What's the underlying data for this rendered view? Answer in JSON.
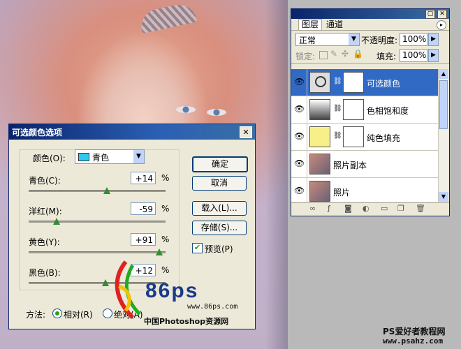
{
  "dialog": {
    "title": "可选颜色选项",
    "colors_label": "颜色(O):",
    "colors_selected": "青色",
    "rows": [
      {
        "label": "青色(C):",
        "value": "+14",
        "unit": "%",
        "percent": 14
      },
      {
        "label": "洋红(M):",
        "value": "-59",
        "unit": "%",
        "percent": -59
      },
      {
        "label": "黄色(Y):",
        "value": "+91",
        "unit": "%",
        "percent": 91
      },
      {
        "label": "黑色(B):",
        "value": "+12",
        "unit": "%",
        "percent": 12
      }
    ],
    "buttons": {
      "ok": "确定",
      "cancel": "取消",
      "load": "载入(L)...",
      "save": "存储(S)..."
    },
    "preview_label": "预览(P)",
    "method_label": "方法:",
    "method_relative": "相对(R)",
    "method_absolute": "绝对(A)"
  },
  "layers_panel": {
    "tabs": [
      "图层",
      "通道"
    ],
    "blend_mode": "正常",
    "opacity_label": "不透明度:",
    "opacity_value": "100%",
    "lock_label": "锁定:",
    "fill_label": "填充:",
    "fill_value": "100%",
    "layers": [
      {
        "name": "可选颜色",
        "selected": true
      },
      {
        "name": "色相饱和度",
        "selected": false
      },
      {
        "name": "纯色填充",
        "selected": false
      },
      {
        "name": "照片副本",
        "selected": false
      },
      {
        "name": "照片",
        "selected": false
      }
    ]
  },
  "watermark": {
    "logo_text": "86ps",
    "url": "www.86ps.com",
    "site_name": "中国Photoshop资源网"
  },
  "footer_watermark": {
    "line1": "PS爱好者教程网",
    "line2": "www.psahz.com"
  },
  "colors": {
    "selection": "#316ac5",
    "cyan_swatch": "#2ec9f0",
    "fill_swatch": "#f7f089"
  }
}
